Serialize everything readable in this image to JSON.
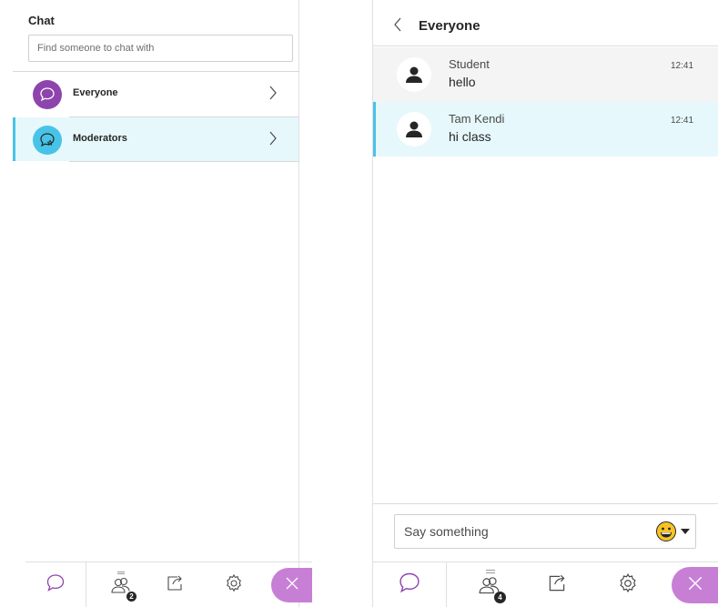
{
  "left_panel": {
    "title": "Chat",
    "search_placeholder": "Find someone to chat with",
    "channels": [
      {
        "label": "Everyone",
        "icon": "chat-bubble-icon",
        "color": "#8e44ad"
      },
      {
        "label": "Moderators",
        "icon": "moderator-chat-icon",
        "color": "#48c3e8"
      }
    ],
    "toolbar": {
      "participants_badge": "2",
      "close_color": "#c77fd6"
    }
  },
  "right_panel": {
    "title": "Everyone",
    "messages": [
      {
        "author": "Student",
        "text": "hello",
        "time": "12:41"
      },
      {
        "author": "Tam Kendi",
        "text": "hi class",
        "time": "12:41"
      }
    ],
    "compose_placeholder": "Say something",
    "toolbar": {
      "participants_badge": "4",
      "close_color": "#c77fd6"
    }
  },
  "colors": {
    "accent": "#48c3e8",
    "everyone_avatar": "#8e44ad",
    "selected_bg": "#e6f8fc"
  }
}
